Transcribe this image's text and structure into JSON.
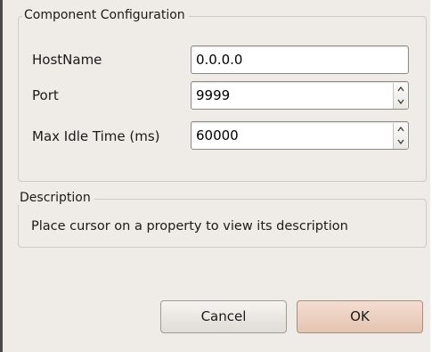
{
  "config_group": {
    "title": "Component Configuration",
    "fields": [
      {
        "label": "HostName",
        "value": "0.0.0.0",
        "spinner": false
      },
      {
        "label": "Port",
        "value": "9999",
        "spinner": true
      },
      {
        "label": "Max Idle Time (ms)",
        "value": "60000",
        "spinner": true
      }
    ]
  },
  "description_group": {
    "title": "Description",
    "text": "Place cursor on a property to view its description"
  },
  "buttons": {
    "cancel_label": "Cancel",
    "ok_label": "OK"
  },
  "icons": {
    "spin_up": "chevron-up-icon",
    "spin_down": "chevron-down-icon"
  },
  "colors": {
    "background": "#efebe7",
    "ok_button": "#e8c9b7",
    "field_border": "#8e8a85"
  }
}
